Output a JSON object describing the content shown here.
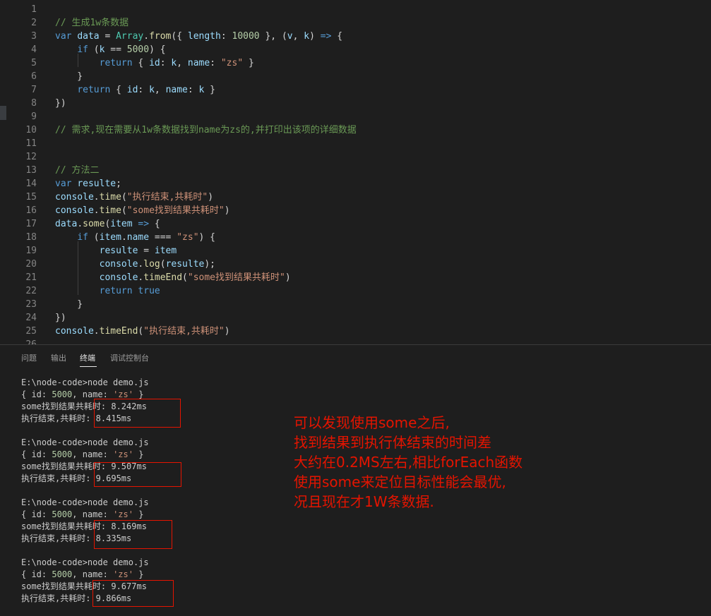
{
  "editor": {
    "line_numbers": [
      "1",
      "2",
      "3",
      "4",
      "5",
      "6",
      "7",
      "8",
      "9",
      "10",
      "11",
      "12",
      "13",
      "14",
      "15",
      "16",
      "17",
      "18",
      "19",
      "20",
      "21",
      "22",
      "23",
      "24",
      "25",
      "26"
    ],
    "lines": [
      [],
      [
        {
          "t": "// 生成1w条数据",
          "c": "cm"
        }
      ],
      [
        {
          "t": "var",
          "c": "kw"
        },
        {
          "t": " ",
          "c": "pl"
        },
        {
          "t": "data",
          "c": "vr"
        },
        {
          "t": " = ",
          "c": "pl"
        },
        {
          "t": "Array",
          "c": "ty"
        },
        {
          "t": ".",
          "c": "pl"
        },
        {
          "t": "from",
          "c": "fn"
        },
        {
          "t": "({ ",
          "c": "pl"
        },
        {
          "t": "length",
          "c": "vr"
        },
        {
          "t": ": ",
          "c": "pl"
        },
        {
          "t": "10000",
          "c": "nu"
        },
        {
          "t": " }, (",
          "c": "pl"
        },
        {
          "t": "v",
          "c": "vr"
        },
        {
          "t": ", ",
          "c": "pl"
        },
        {
          "t": "k",
          "c": "vr"
        },
        {
          "t": ") ",
          "c": "pl"
        },
        {
          "t": "=>",
          "c": "kw"
        },
        {
          "t": " {",
          "c": "pl"
        }
      ],
      [
        {
          "t": "    ",
          "c": "pl"
        },
        {
          "t": "if",
          "c": "kw"
        },
        {
          "t": " (",
          "c": "pl"
        },
        {
          "t": "k",
          "c": "vr"
        },
        {
          "t": " == ",
          "c": "pl"
        },
        {
          "t": "5000",
          "c": "nu"
        },
        {
          "t": ") {",
          "c": "pl"
        }
      ],
      [
        {
          "t": "        ",
          "c": "pl"
        },
        {
          "t": "return",
          "c": "kw"
        },
        {
          "t": " { ",
          "c": "pl"
        },
        {
          "t": "id",
          "c": "vr"
        },
        {
          "t": ": ",
          "c": "pl"
        },
        {
          "t": "k",
          "c": "vr"
        },
        {
          "t": ", ",
          "c": "pl"
        },
        {
          "t": "name",
          "c": "vr"
        },
        {
          "t": ": ",
          "c": "pl"
        },
        {
          "t": "\"zs\"",
          "c": "st"
        },
        {
          "t": " }",
          "c": "pl"
        }
      ],
      [
        {
          "t": "    }",
          "c": "pl"
        }
      ],
      [
        {
          "t": "    ",
          "c": "pl"
        },
        {
          "t": "return",
          "c": "kw"
        },
        {
          "t": " { ",
          "c": "pl"
        },
        {
          "t": "id",
          "c": "vr"
        },
        {
          "t": ": ",
          "c": "pl"
        },
        {
          "t": "k",
          "c": "vr"
        },
        {
          "t": ", ",
          "c": "pl"
        },
        {
          "t": "name",
          "c": "vr"
        },
        {
          "t": ": ",
          "c": "pl"
        },
        {
          "t": "k",
          "c": "vr"
        },
        {
          "t": " }",
          "c": "pl"
        }
      ],
      [
        {
          "t": "})",
          "c": "pl"
        }
      ],
      [],
      [
        {
          "t": "// 需求,现在需要从1w条数据找到name为zs的,并打印出该项的详细数据",
          "c": "cm"
        }
      ],
      [],
      [],
      [
        {
          "t": "// 方法二",
          "c": "cm"
        }
      ],
      [
        {
          "t": "var",
          "c": "kw"
        },
        {
          "t": " ",
          "c": "pl"
        },
        {
          "t": "resulte",
          "c": "vr"
        },
        {
          "t": ";",
          "c": "pl"
        }
      ],
      [
        {
          "t": "console",
          "c": "vr"
        },
        {
          "t": ".",
          "c": "pl"
        },
        {
          "t": "time",
          "c": "fn"
        },
        {
          "t": "(",
          "c": "pl"
        },
        {
          "t": "\"执行结束,共耗时\"",
          "c": "st"
        },
        {
          "t": ")",
          "c": "pl"
        }
      ],
      [
        {
          "t": "console",
          "c": "vr"
        },
        {
          "t": ".",
          "c": "pl"
        },
        {
          "t": "time",
          "c": "fn"
        },
        {
          "t": "(",
          "c": "pl"
        },
        {
          "t": "\"some找到结果共耗时\"",
          "c": "st"
        },
        {
          "t": ")",
          "c": "pl"
        }
      ],
      [
        {
          "t": "data",
          "c": "vr"
        },
        {
          "t": ".",
          "c": "pl"
        },
        {
          "t": "some",
          "c": "fn"
        },
        {
          "t": "(",
          "c": "pl"
        },
        {
          "t": "item",
          "c": "vr"
        },
        {
          "t": " ",
          "c": "pl"
        },
        {
          "t": "=>",
          "c": "kw"
        },
        {
          "t": " {",
          "c": "pl"
        }
      ],
      [
        {
          "t": "    ",
          "c": "pl"
        },
        {
          "t": "if",
          "c": "kw"
        },
        {
          "t": " (",
          "c": "pl"
        },
        {
          "t": "item",
          "c": "vr"
        },
        {
          "t": ".",
          "c": "pl"
        },
        {
          "t": "name",
          "c": "vr"
        },
        {
          "t": " === ",
          "c": "pl"
        },
        {
          "t": "\"zs\"",
          "c": "st"
        },
        {
          "t": ") {",
          "c": "pl"
        }
      ],
      [
        {
          "t": "        ",
          "c": "pl"
        },
        {
          "t": "resulte",
          "c": "vr"
        },
        {
          "t": " = ",
          "c": "pl"
        },
        {
          "t": "item",
          "c": "vr"
        }
      ],
      [
        {
          "t": "        ",
          "c": "pl"
        },
        {
          "t": "console",
          "c": "vr"
        },
        {
          "t": ".",
          "c": "pl"
        },
        {
          "t": "log",
          "c": "fn"
        },
        {
          "t": "(",
          "c": "pl"
        },
        {
          "t": "resulte",
          "c": "vr"
        },
        {
          "t": ");",
          "c": "pl"
        }
      ],
      [
        {
          "t": "        ",
          "c": "pl"
        },
        {
          "t": "console",
          "c": "vr"
        },
        {
          "t": ".",
          "c": "pl"
        },
        {
          "t": "timeEnd",
          "c": "fn"
        },
        {
          "t": "(",
          "c": "pl"
        },
        {
          "t": "\"some找到结果共耗时\"",
          "c": "st"
        },
        {
          "t": ")",
          "c": "pl"
        }
      ],
      [
        {
          "t": "        ",
          "c": "pl"
        },
        {
          "t": "return",
          "c": "kw"
        },
        {
          "t": " ",
          "c": "pl"
        },
        {
          "t": "true",
          "c": "kw"
        }
      ],
      [
        {
          "t": "    }",
          "c": "pl"
        }
      ],
      [
        {
          "t": "})",
          "c": "pl"
        }
      ],
      [
        {
          "t": "console",
          "c": "vr"
        },
        {
          "t": ".",
          "c": "pl"
        },
        {
          "t": "timeEnd",
          "c": "fn"
        },
        {
          "t": "(",
          "c": "pl"
        },
        {
          "t": "\"执行结束,共耗时\"",
          "c": "st"
        },
        {
          "t": ")",
          "c": "pl"
        }
      ],
      []
    ]
  },
  "panel": {
    "tabs": [
      "问题",
      "输出",
      "终端",
      "调试控制台"
    ],
    "active_tab": "终端"
  },
  "terminal": {
    "runs": [
      {
        "prompt": "E:\\node-code>node demo.js",
        "obj_prefix": "{ id: ",
        "obj_id": "5000",
        "obj_mid": ", name: ",
        "obj_name": "'zs'",
        "obj_suffix": " }",
        "some_line": "some找到结果共耗时: 8.242ms",
        "total_line": "执行结束,共耗时: 8.415ms"
      },
      {
        "prompt": "E:\\node-code>node demo.js",
        "obj_prefix": "{ id: ",
        "obj_id": "5000",
        "obj_mid": ", name: ",
        "obj_name": "'zs'",
        "obj_suffix": " }",
        "some_line": "some找到结果共耗时: 9.507ms",
        "total_line": "执行结束,共耗时: 9.695ms"
      },
      {
        "prompt": "E:\\node-code>node demo.js",
        "obj_prefix": "{ id: ",
        "obj_id": "5000",
        "obj_mid": ", name: ",
        "obj_name": "'zs'",
        "obj_suffix": " }",
        "some_line": "some找到结果共耗时: 8.169ms",
        "total_line": "执行结束,共耗时: 8.335ms"
      },
      {
        "prompt": "E:\\node-code>node demo.js",
        "obj_prefix": "{ id: ",
        "obj_id": "5000",
        "obj_mid": ", name: ",
        "obj_name": "'zs'",
        "obj_suffix": " }",
        "some_line": "some找到结果共耗时: 9.677ms",
        "total_line": "执行结束,共耗时: 9.866ms"
      }
    ]
  },
  "annotation": {
    "lines": [
      "可以发现使用some之后,",
      "找到结果到执行体结束的时间差",
      "大约在0.2MS左右,相比forEach函数",
      "使用some来定位目标性能会最优,",
      "况且现在才1W条数据."
    ],
    "color": "#e51400"
  }
}
